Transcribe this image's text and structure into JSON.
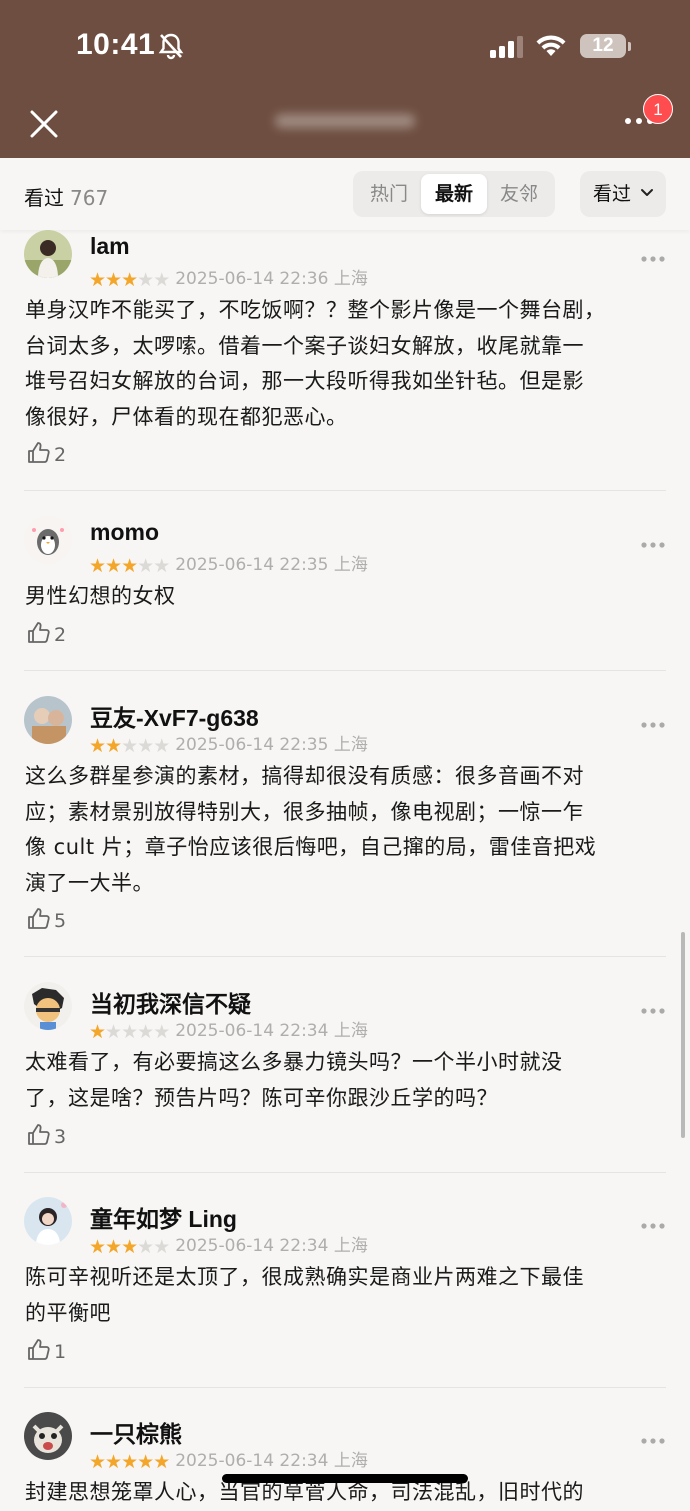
{
  "status": {
    "time": "10:41",
    "battery": "12"
  },
  "nav": {
    "badge_count": "1"
  },
  "filter": {
    "seen_label": "看过",
    "seen_count": "767",
    "tabs": [
      "热门",
      "最新",
      "友邻"
    ],
    "active_tab": "最新",
    "dropdown_label": "看过"
  },
  "comments": [
    {
      "username": "lam",
      "rating": 3,
      "date": "2025-06-14 22:36",
      "location": "上海",
      "lines": [
        "单身汉咋不能买了，不吃饭啊？？整个影片像是一个舞台剧，",
        "台词太多，太啰嗦。借着一个案子谈妇女解放，收尾就靠一",
        "堆号召妇女解放的台词，那一大段听得我如坐针毡。但是影",
        "像很好，尸体看的现在都犯恶心。"
      ],
      "likes": "2"
    },
    {
      "username": "momo",
      "rating": 3,
      "date": "2025-06-14 22:35",
      "location": "上海",
      "lines": [
        "男性幻想的女权"
      ],
      "likes": "2"
    },
    {
      "username": "豆友-XvF7-g638",
      "rating": 2,
      "date": "2025-06-14 22:35",
      "location": "上海",
      "lines": [
        "这么多群星参演的素材，搞得却很没有质感：很多音画不对",
        "应；素材景别放得特别大，很多抽帧，像电视剧；一惊一乍",
        "像 cult 片；章子怡应该很后悔吧，自己撺的局，雷佳音把戏",
        "演了一大半。"
      ],
      "likes": "5"
    },
    {
      "username": "当初我深信不疑",
      "rating": 1,
      "date": "2025-06-14 22:34",
      "location": "上海",
      "lines": [
        "太难看了，有必要搞这么多暴力镜头吗？一个半小时就没",
        "了，这是啥？预告片吗？陈可辛你跟沙丘学的吗？"
      ],
      "likes": "3"
    },
    {
      "username": "童年如梦 Ling",
      "rating": 3,
      "date": "2025-06-14 22:34",
      "location": "上海",
      "lines": [
        "陈可辛视听还是太顶了，很成熟确实是商业片两难之下最佳",
        "的平衡吧"
      ],
      "likes": "1"
    },
    {
      "username": "一只棕熊",
      "rating": 5,
      "date": "2025-06-14 22:34",
      "location": "上海",
      "lines": [
        "封建思想笼罩人心，当官的草菅人命，司法混乱，旧时代的"
      ],
      "likes": ""
    }
  ],
  "colors": {
    "header_bg": "#6e4e40",
    "star_on": "#f4a62a",
    "star_off": "#dcdad7",
    "badge": "#ff4d4f"
  }
}
